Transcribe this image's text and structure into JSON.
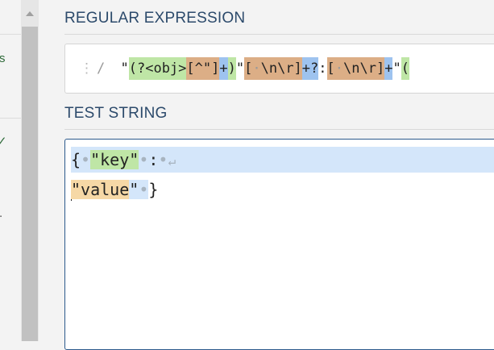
{
  "left_panel": {
    "fragments": [
      "s",
      "✓",
      "."
    ]
  },
  "regex_section": {
    "title": "REGULAR EXPRESSION",
    "drag_handle": "⋮",
    "delimiter": "/",
    "tokens": [
      {
        "text": "\"",
        "hl": "none"
      },
      {
        "text": "(?<obj>",
        "hl": "g"
      },
      {
        "text": "[^\"]",
        "hl": "o"
      },
      {
        "text": "+",
        "hl": "b"
      },
      {
        "text": ")",
        "hl": "g"
      },
      {
        "text": "\"",
        "hl": "none"
      },
      {
        "text": "[",
        "hl": "o"
      },
      {
        "text": "·",
        "hl": "o-dot"
      },
      {
        "text": "\\n\\r]",
        "hl": "o"
      },
      {
        "text": "+?",
        "hl": "b"
      },
      {
        "text": ":",
        "hl": "none"
      },
      {
        "text": "[",
        "hl": "o"
      },
      {
        "text": "·",
        "hl": "o-dot"
      },
      {
        "text": "\\n\\r]",
        "hl": "o"
      },
      {
        "text": "+",
        "hl": "b"
      },
      {
        "text": "\"",
        "hl": "none"
      },
      {
        "text": "(",
        "hl": "g"
      }
    ]
  },
  "test_section": {
    "title": "TEST STRING",
    "line1": {
      "open": "{",
      "sp1": "•",
      "quote1": "\"",
      "key": "key",
      "quote2": "\"",
      "sp2": "•",
      "colon": ":",
      "sp3": "•",
      "return": "↵"
    },
    "line2": {
      "quote1": "\"",
      "value": "value",
      "quote2": "\"",
      "sp": "•",
      "close": "}"
    }
  },
  "colors": {
    "title": "#2c4a6b",
    "group_match": "#bfe6a6",
    "char_class": "#dcae86",
    "quantifier": "#9ec3ef",
    "line_highlight": "#d4e6fa",
    "value_match": "#f6d8a6",
    "active_border": "#2c5a8c"
  }
}
